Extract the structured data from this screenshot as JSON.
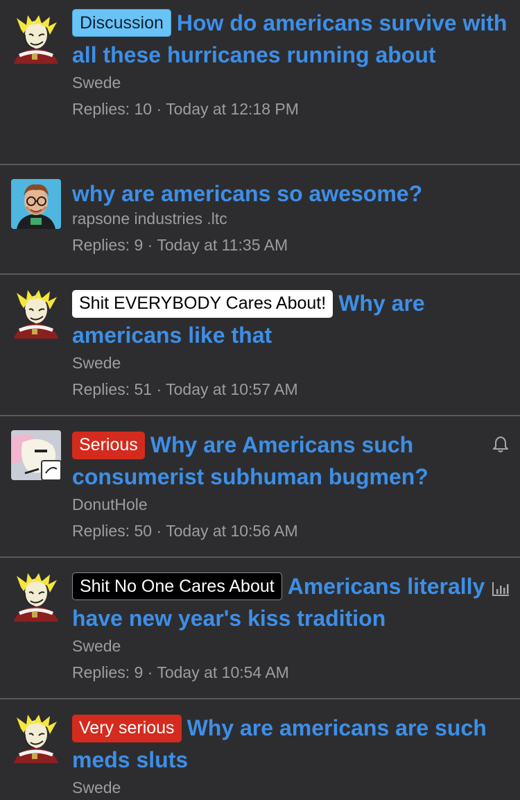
{
  "threads": [
    {
      "prefix": "Discussion",
      "title": "How do americans survive with all these hurricanes running about",
      "author": "Swede",
      "replies": "Replies: 10",
      "sep": "·",
      "time": "Today at 12:18 PM",
      "avatar": "yellow-hair-avatar"
    },
    {
      "prefix": "",
      "title": "why are americans so awesome?",
      "author": "rapsone industries .ltc",
      "replies": "Replies: 9",
      "sep": "·",
      "time": "Today at 11:35 AM",
      "avatar": "glasses-man-avatar"
    },
    {
      "prefix": "Shit EVERYBODY Cares About!",
      "title": "Why are americans like that",
      "author": "Swede",
      "replies": "Replies: 51",
      "sep": "·",
      "time": "Today at 10:57 AM",
      "avatar": "yellow-hair-avatar"
    },
    {
      "prefix": "Serious",
      "title": "Why are Americans such consumerist subhuman bugmen?",
      "author": "DonutHole",
      "replies": "Replies: 50",
      "sep": "·",
      "time": "Today at 10:56 AM",
      "avatar": "pink-pony-avatar",
      "right_icon": "bell-icon"
    },
    {
      "prefix": "Shit No One Cares About",
      "title": "Americans literally have new year's kiss tradition",
      "author": "Swede",
      "replies": "Replies: 9",
      "sep": "·",
      "time": "Today at 10:54 AM",
      "avatar": "yellow-hair-avatar",
      "right_icon": "poll-chart-icon"
    },
    {
      "prefix": "Very serious",
      "title": "Why are americans are such meds sluts",
      "author": "Swede",
      "avatar": "yellow-hair-avatar"
    }
  ],
  "colors": {
    "background": "#2d2d2f",
    "title": "#3d8fe8",
    "meta": "#9d9da1",
    "divider": "#5a5a5c",
    "prefix_discussion": "#6ac3f5",
    "prefix_red": "#d42b1e"
  }
}
